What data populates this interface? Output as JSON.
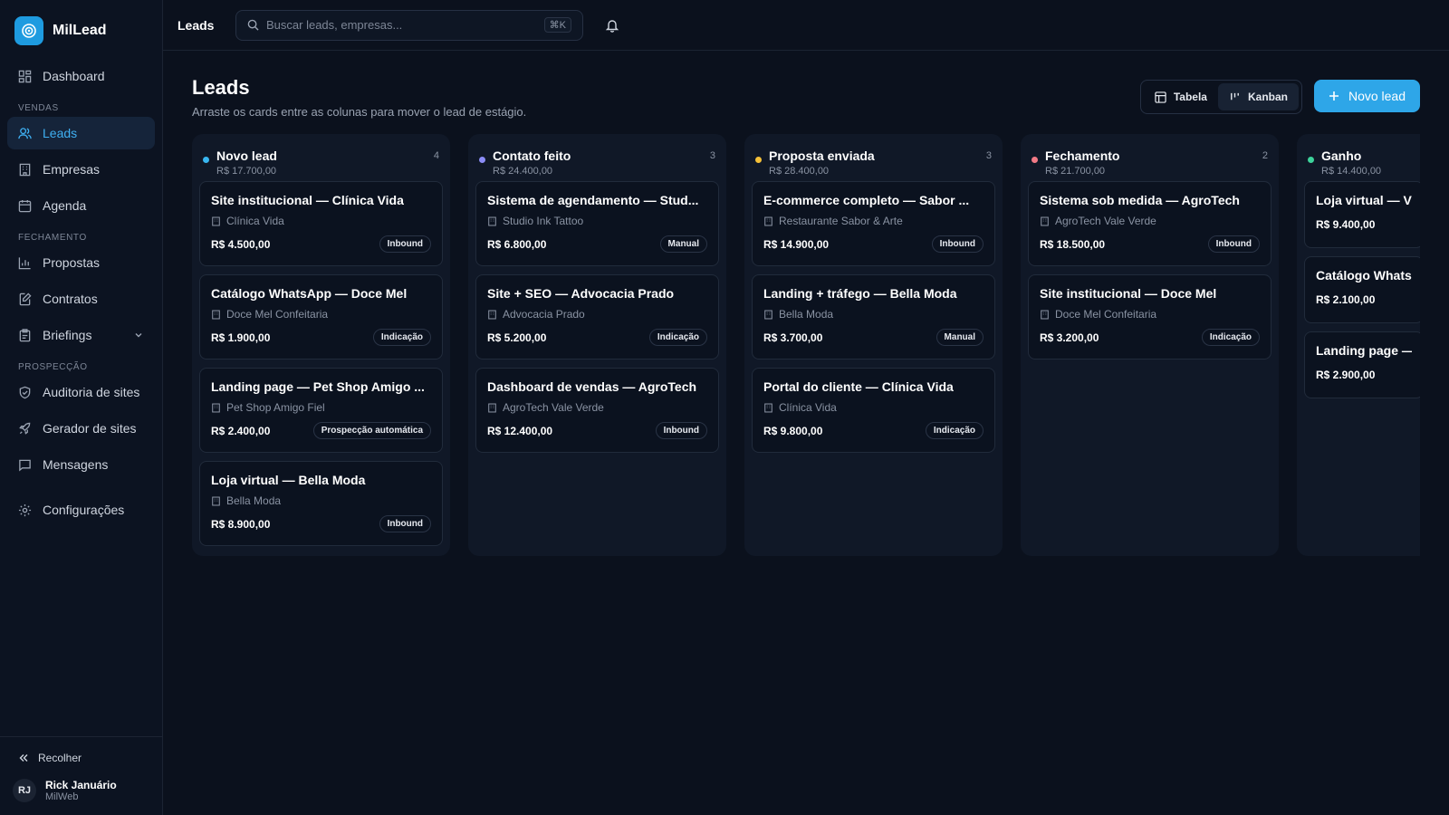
{
  "app": {
    "name": "MilLead"
  },
  "sidebar": {
    "dashboard": "Dashboard",
    "section_vendas": "VENDAS",
    "leads": "Leads",
    "empresas": "Empresas",
    "agenda": "Agenda",
    "section_fechamento": "FECHAMENTO",
    "propostas": "Propostas",
    "contratos": "Contratos",
    "briefings": "Briefings",
    "section_prospeccao": "PROSPECÇÃO",
    "auditoria": "Auditoria de sites",
    "gerador": "Gerador de sites",
    "mensagens": "Mensagens",
    "configuracoes": "Configurações",
    "collapse": "Recolher",
    "user": {
      "initials": "RJ",
      "name": "Rick Januário",
      "org": "MilWeb"
    }
  },
  "topbar": {
    "title": "Leads",
    "search_placeholder": "Buscar leads, empresas...",
    "shortcut": "⌘K"
  },
  "header": {
    "title": "Leads",
    "subtitle": "Arraste os cards entre as colunas para mover o lead de estágio.",
    "view_table": "Tabela",
    "view_kanban": "Kanban",
    "active_view": "Kanban",
    "new_lead": "Novo lead"
  },
  "colors": {
    "accent": "#2ea6e8",
    "novo": "#38b6f0",
    "contato": "#8b8cf6",
    "proposta": "#f5c038",
    "fechamento": "#f27a86",
    "ganho": "#3dd39b"
  },
  "columns": [
    {
      "title": "Novo lead",
      "total": "R$ 17.700,00",
      "count": "4",
      "cards": [
        {
          "title": "Site institucional — Clínica Vida",
          "company": "Clínica Vida",
          "value": "R$ 4.500,00",
          "source": "Inbound"
        },
        {
          "title": "Catálogo WhatsApp — Doce Mel",
          "company": "Doce Mel Confeitaria",
          "value": "R$ 1.900,00",
          "source": "Indicação"
        },
        {
          "title": "Landing page — Pet Shop Amigo ...",
          "company": "Pet Shop Amigo Fiel",
          "value": "R$ 2.400,00",
          "source": "Prospecção automática"
        },
        {
          "title": "Loja virtual — Bella Moda",
          "company": "Bella Moda",
          "value": "R$ 8.900,00",
          "source": "Inbound"
        }
      ]
    },
    {
      "title": "Contato feito",
      "total": "R$ 24.400,00",
      "count": "3",
      "cards": [
        {
          "title": "Sistema de agendamento — Stud...",
          "company": "Studio Ink Tattoo",
          "value": "R$ 6.800,00",
          "source": "Manual"
        },
        {
          "title": "Site + SEO — Advocacia Prado",
          "company": "Advocacia Prado",
          "value": "R$ 5.200,00",
          "source": "Indicação"
        },
        {
          "title": "Dashboard de vendas — AgroTech",
          "company": "AgroTech Vale Verde",
          "value": "R$ 12.400,00",
          "source": "Inbound"
        }
      ]
    },
    {
      "title": "Proposta enviada",
      "total": "R$ 28.400,00",
      "count": "3",
      "cards": [
        {
          "title": "E-commerce completo — Sabor ...",
          "company": "Restaurante Sabor & Arte",
          "value": "R$ 14.900,00",
          "source": "Inbound"
        },
        {
          "title": "Landing + tráfego — Bella Moda",
          "company": "Bella Moda",
          "value": "R$ 3.700,00",
          "source": "Manual"
        },
        {
          "title": "Portal do cliente — Clínica Vida",
          "company": "Clínica Vida",
          "value": "R$ 9.800,00",
          "source": "Indicação"
        }
      ]
    },
    {
      "title": "Fechamento",
      "total": "R$ 21.700,00",
      "count": "2",
      "cards": [
        {
          "title": "Sistema sob medida — AgroTech",
          "company": "AgroTech Vale Verde",
          "value": "R$ 18.500,00",
          "source": "Inbound"
        },
        {
          "title": "Site institucional — Doce Mel",
          "company": "Doce Mel Confeitaria",
          "value": "R$ 3.200,00",
          "source": "Indicação"
        }
      ]
    },
    {
      "title": "Ganho",
      "total": "R$ 14.400,00",
      "cards": [
        {
          "title": "Loja virtual — Vitri",
          "value": "R$ 9.400,00"
        },
        {
          "title": "Catálogo WhatsAp",
          "value": "R$ 2.100,00"
        },
        {
          "title": "Landing page — St",
          "value": "R$ 2.900,00"
        }
      ]
    }
  ]
}
